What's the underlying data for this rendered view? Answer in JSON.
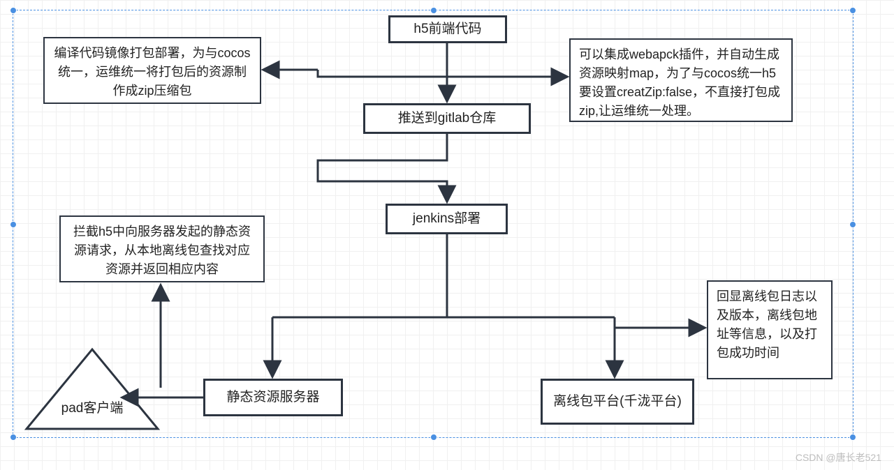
{
  "nodes": {
    "h5": "h5前端代码",
    "gitlab": "推送到gitlab仓库",
    "jenkins": "jenkins部署",
    "static": "静态资源服务器",
    "offline": "离线包平台(千泷平台)",
    "pad": "pad客户端"
  },
  "notes": {
    "compile": "编译代码镜像打包部署，为与cocos统一，运维统一将打包后的资源制作成zip压缩包",
    "webpack": "可以集成webapck插件，并自动生成资源映射map，为了与cocos统一h5要设置creatZip:false，不直接打包成zip,让运维统一处理。",
    "intercept": "拦截h5中向服务器发起的静态资源请求，从本地离线包查找对应资源并返回相应内容",
    "log": "回显离线包日志以及版本，离线包地址等信息，以及打包成功时间"
  },
  "watermark": "CSDN @唐长老521"
}
